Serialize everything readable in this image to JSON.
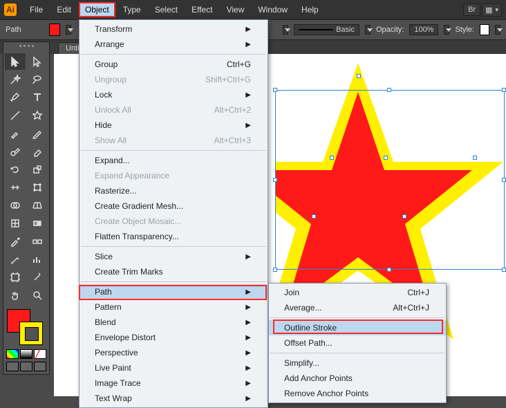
{
  "menubar": {
    "items": [
      "File",
      "Edit",
      "Object",
      "Type",
      "Select",
      "Effect",
      "View",
      "Window",
      "Help"
    ],
    "highlight": "Object"
  },
  "controlbar": {
    "mode_label": "Path",
    "fill_color": "#ff1a1a",
    "basic_label": "Basic",
    "opacity_label": "Opacity:",
    "opacity_value": "100%",
    "style_label": "Style:"
  },
  "tabbar": {
    "active_tab": "Untitl"
  },
  "object_menu": {
    "items": [
      {
        "label": "Transform",
        "submenu": true
      },
      {
        "label": "Arrange",
        "submenu": true
      },
      {
        "sep": true
      },
      {
        "label": "Group",
        "shortcut": "Ctrl+G"
      },
      {
        "label": "Ungroup",
        "shortcut": "Shift+Ctrl+G",
        "disabled": true
      },
      {
        "label": "Lock",
        "submenu": true
      },
      {
        "label": "Unlock All",
        "shortcut": "Alt+Ctrl+2",
        "disabled": true
      },
      {
        "label": "Hide",
        "submenu": true
      },
      {
        "label": "Show All",
        "shortcut": "Alt+Ctrl+3",
        "disabled": true
      },
      {
        "sep": true
      },
      {
        "label": "Expand..."
      },
      {
        "label": "Expand Appearance",
        "disabled": true
      },
      {
        "label": "Rasterize..."
      },
      {
        "label": "Create Gradient Mesh..."
      },
      {
        "label": "Create Object Mosaic...",
        "disabled": true
      },
      {
        "label": "Flatten Transparency..."
      },
      {
        "sep": true
      },
      {
        "label": "Slice",
        "submenu": true
      },
      {
        "label": "Create Trim Marks"
      },
      {
        "sep": true
      },
      {
        "label": "Path",
        "submenu": true,
        "highlight": true
      },
      {
        "label": "Pattern",
        "submenu": true
      },
      {
        "label": "Blend",
        "submenu": true
      },
      {
        "label": "Envelope Distort",
        "submenu": true
      },
      {
        "label": "Perspective",
        "submenu": true
      },
      {
        "label": "Live Paint",
        "submenu": true
      },
      {
        "label": "Image Trace",
        "submenu": true
      },
      {
        "label": "Text Wrap",
        "submenu": true
      }
    ]
  },
  "path_submenu": {
    "items": [
      {
        "label": "Join",
        "shortcut": "Ctrl+J"
      },
      {
        "label": "Average...",
        "shortcut": "Alt+Ctrl+J"
      },
      {
        "sep": true
      },
      {
        "label": "Outline Stroke",
        "highlight": true
      },
      {
        "label": "Offset Path..."
      },
      {
        "sep": true
      },
      {
        "label": "Simplify..."
      },
      {
        "label": "Add Anchor Points"
      },
      {
        "label": "Remove Anchor Points"
      }
    ]
  },
  "artwork": {
    "shape": "star",
    "fill_color": "#ff1a1a",
    "stroke_color": "#ffef00",
    "selection_handles": true
  },
  "tools": {
    "fill_color": "#ff1a1a",
    "stroke_color": "#ffef00"
  }
}
